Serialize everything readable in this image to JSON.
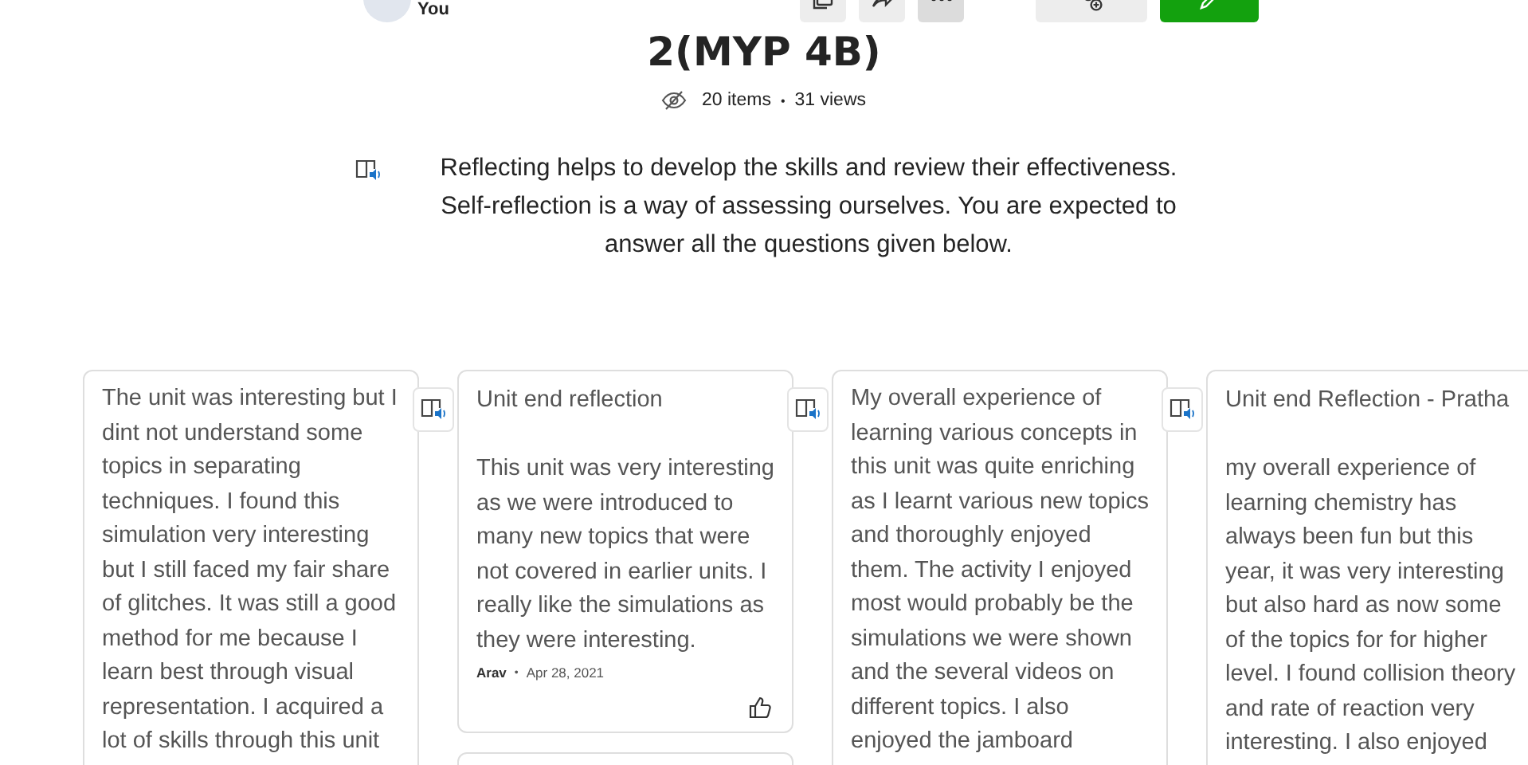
{
  "header": {
    "user": "You"
  },
  "title": "2(MYP 4B)",
  "meta": {
    "items": "20 items",
    "separator": "•",
    "views": "31 views"
  },
  "description": "Reflecting helps to develop the skills and review their effectiveness. Self-reflection is a way of assessing ourselves. You are expected to answer all the questions given below.",
  "columns": [
    {
      "posts": [
        {
          "kind": "post",
          "body": "The unit was interesting but I dint not understand some topics in separating techniques. I found this simulation very interesting but I still faced my fair share of glitches. It was still a good method for me because I learn best through visual representation. I acquired a lot of skills through this unit"
        }
      ]
    },
    {
      "posts": [
        {
          "kind": "post",
          "title": "Unit end reflection",
          "body": "This unit was very interesting as we were introduced to many new topics that were not covered in earlier units. I really like the simulations as they were interesting.",
          "author": "Arav",
          "separator": "•",
          "date": "Apr 28, 2021"
        },
        {
          "kind": "placeholder"
        }
      ]
    },
    {
      "posts": [
        {
          "kind": "post",
          "body": "My overall experience of learning various concepts in this unit was quite enriching as I learnt various new topics and thoroughly enjoyed them. The activity I enjoyed most would probably be the simulations we were shown and the several videos on different topics. I also enjoyed the jamboard"
        }
      ]
    },
    {
      "posts": [
        {
          "kind": "post",
          "title": "Unit end Reflection - Pratha",
          "body": "my overall experience of learning chemistry has always been fun but this year, it was very interesting but also hard as now some of the topics for for higher level. I found collision theory and rate of reaction very interesting. I also enjoyed"
        }
      ]
    }
  ]
}
